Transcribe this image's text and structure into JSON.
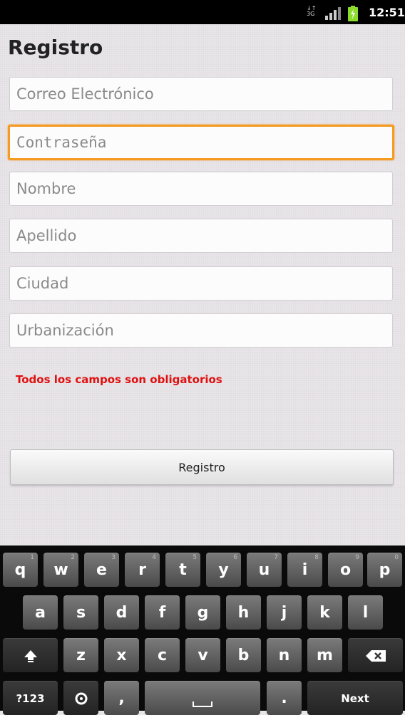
{
  "status_bar": {
    "network": "3G",
    "time": "12:51"
  },
  "page": {
    "title": "Registro"
  },
  "form": {
    "fields": [
      {
        "placeholder": "Correo Electrónico",
        "value": ""
      },
      {
        "placeholder": "Contraseña",
        "value": ""
      },
      {
        "placeholder": "Nombre",
        "value": ""
      },
      {
        "placeholder": "Apellido",
        "value": ""
      },
      {
        "placeholder": "Ciudad",
        "value": ""
      },
      {
        "placeholder": "Urbanización",
        "value": ""
      }
    ],
    "notice": "Todos los campos son obligatorios",
    "submit_label": "Registro"
  },
  "keyboard": {
    "row1": [
      "q",
      "w",
      "e",
      "r",
      "t",
      "y",
      "u",
      "i",
      "o",
      "p"
    ],
    "row1_hints": [
      "1",
      "2",
      "3",
      "4",
      "5",
      "6",
      "7",
      "8",
      "9",
      "0"
    ],
    "row2": [
      "a",
      "s",
      "d",
      "f",
      "g",
      "h",
      "j",
      "k",
      "l"
    ],
    "row3": [
      "z",
      "x",
      "c",
      "v",
      "b",
      "n",
      "m"
    ],
    "symbols_label": "?123",
    "comma_label": ",",
    "period_label": ".",
    "next_label": "Next",
    "colors": {
      "accent_focus": "#f59b21",
      "notice": "#e01010"
    }
  }
}
